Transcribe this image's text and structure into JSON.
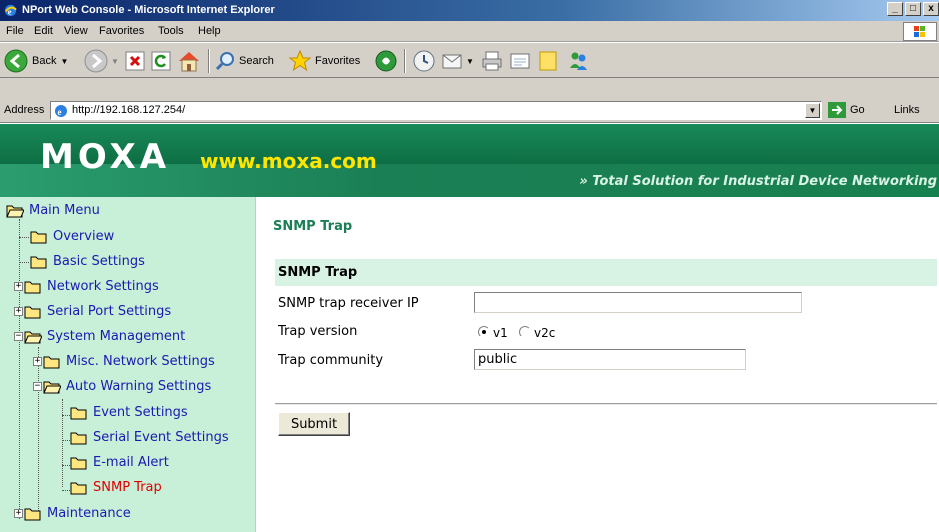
{
  "window": {
    "title": "NPort Web Console - Microsoft Internet Explorer",
    "controls": {
      "minimize": "_",
      "maximize": "□",
      "close": "x"
    }
  },
  "menubar": {
    "items": [
      "File",
      "Edit",
      "View",
      "Favorites",
      "Tools",
      "Help"
    ]
  },
  "toolbar": {
    "back_label": "Back",
    "search_label": "Search",
    "favorites_label": "Favorites"
  },
  "address_bar": {
    "label": "Address",
    "url": "http://192.168.127.254/",
    "go_label": "Go",
    "links_label": "Links"
  },
  "banner": {
    "logo": "MOXA",
    "url": "www.moxa.com",
    "tagline": "» Total Solution for Industrial Device Networking"
  },
  "nav": {
    "items": [
      {
        "label": "Main Menu",
        "state": "open",
        "active": false
      },
      {
        "label": "Overview",
        "state": "leaf",
        "active": false
      },
      {
        "label": "Basic Settings",
        "state": "leaf",
        "active": false
      },
      {
        "label": "Network Settings",
        "state": "collapsed",
        "active": false
      },
      {
        "label": "Serial Port Settings",
        "state": "collapsed",
        "active": false
      },
      {
        "label": "System Management",
        "state": "expanded",
        "active": false
      },
      {
        "label": "Misc. Network Settings",
        "state": "collapsed",
        "active": false
      },
      {
        "label": "Auto Warning Settings",
        "state": "expanded",
        "active": false
      },
      {
        "label": "Event Settings",
        "state": "leaf",
        "active": false
      },
      {
        "label": "Serial Event Settings",
        "state": "leaf",
        "active": false
      },
      {
        "label": "E-mail Alert",
        "state": "leaf",
        "active": false
      },
      {
        "label": "SNMP Trap",
        "state": "leaf",
        "active": true
      },
      {
        "label": "Maintenance",
        "state": "collapsed",
        "active": false
      }
    ]
  },
  "main": {
    "page_title": "SNMP Trap",
    "section_title": "SNMP Trap",
    "fields": {
      "receiver_ip": {
        "label": "SNMP trap receiver IP",
        "value": ""
      },
      "trap_version": {
        "label": "Trap version",
        "options": [
          "v1",
          "v2c"
        ],
        "selected": "v1"
      },
      "community": {
        "label": "Trap community",
        "value": "public"
      }
    },
    "submit_label": "Submit"
  },
  "colors": {
    "banner_green": "#0d6e44",
    "nav_background": "#c8f0d8",
    "section_background": "#d8f3e4",
    "title_green": "#1b7f55",
    "active_link": "#e00000",
    "url_yellow": "#ffe600"
  }
}
